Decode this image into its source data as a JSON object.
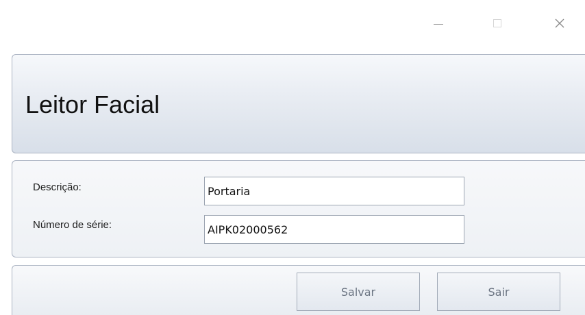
{
  "window": {
    "controls": {
      "minimize_icon": "minimize-icon",
      "maximize_icon": "maximize-icon",
      "close_glyph": "✕"
    }
  },
  "header": {
    "title": "Leitor Facial"
  },
  "form": {
    "descricao": {
      "label": "Descrição:",
      "value": "Portaria"
    },
    "numero_serie": {
      "label": "Número de série:",
      "value": "AIPK02000562"
    }
  },
  "footer": {
    "save_label": "Salvar",
    "exit_label": "Sair"
  }
}
